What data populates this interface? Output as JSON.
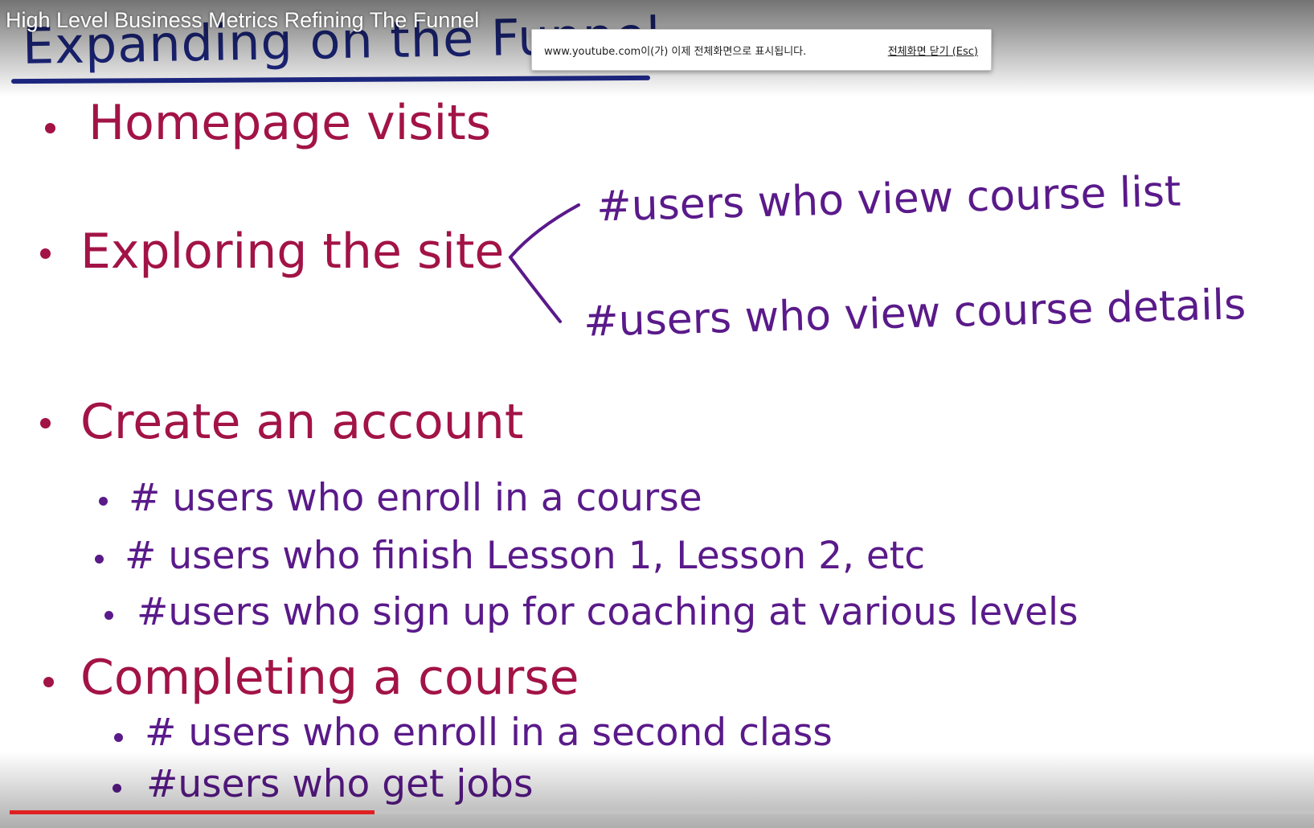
{
  "video": {
    "title": "High Level Business Metrics Refining The Funnel",
    "progress": 0.28
  },
  "fullscreen_notice": {
    "message": "www.youtube.com이(가) 이제 전체화면으로 표시됩니다.",
    "exit_label": "전체화면 닫기 (Esc)"
  },
  "whiteboard": {
    "heading": "Expanding on the Funnel",
    "items": {
      "homepage": "Homepage visits",
      "exploring": "Exploring the site",
      "exploring_branches": [
        "#users who view course list",
        "#users who view course details"
      ],
      "account": "Create an account",
      "account_subs": [
        "# users who enroll in a course",
        "# users who finish Lesson 1, Lesson 2, etc",
        "#users who sign up for coaching at various levels"
      ],
      "completing": "Completing a course",
      "completing_subs": [
        "# users who enroll in a second class",
        "#users who get jobs"
      ]
    }
  },
  "colors": {
    "heading": "#1f2a8a",
    "main_items": "#a21346",
    "sub_items": "#5a1a8a",
    "progress": "#e02020"
  }
}
